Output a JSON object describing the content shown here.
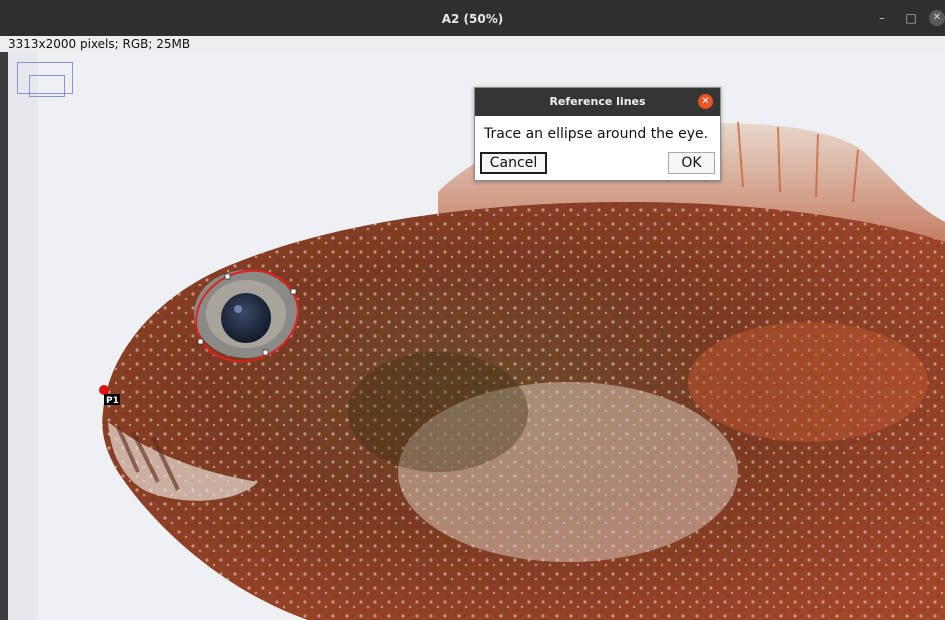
{
  "window": {
    "title": "A2 (50%)",
    "controls": {
      "minimize": "–",
      "maximize": "□",
      "close": "✕"
    }
  },
  "image_info": "3313x2000 pixels; RGB; 25MB",
  "overlay": {
    "point_label": "P1",
    "ellipse_color": "#e02020",
    "point_color": "#e01010"
  },
  "dialog": {
    "title": "Reference lines",
    "message": "Trace an ellipse around the eye.",
    "cancel_label": "Cancel",
    "ok_label": "OK",
    "close_glyph": "✕"
  }
}
